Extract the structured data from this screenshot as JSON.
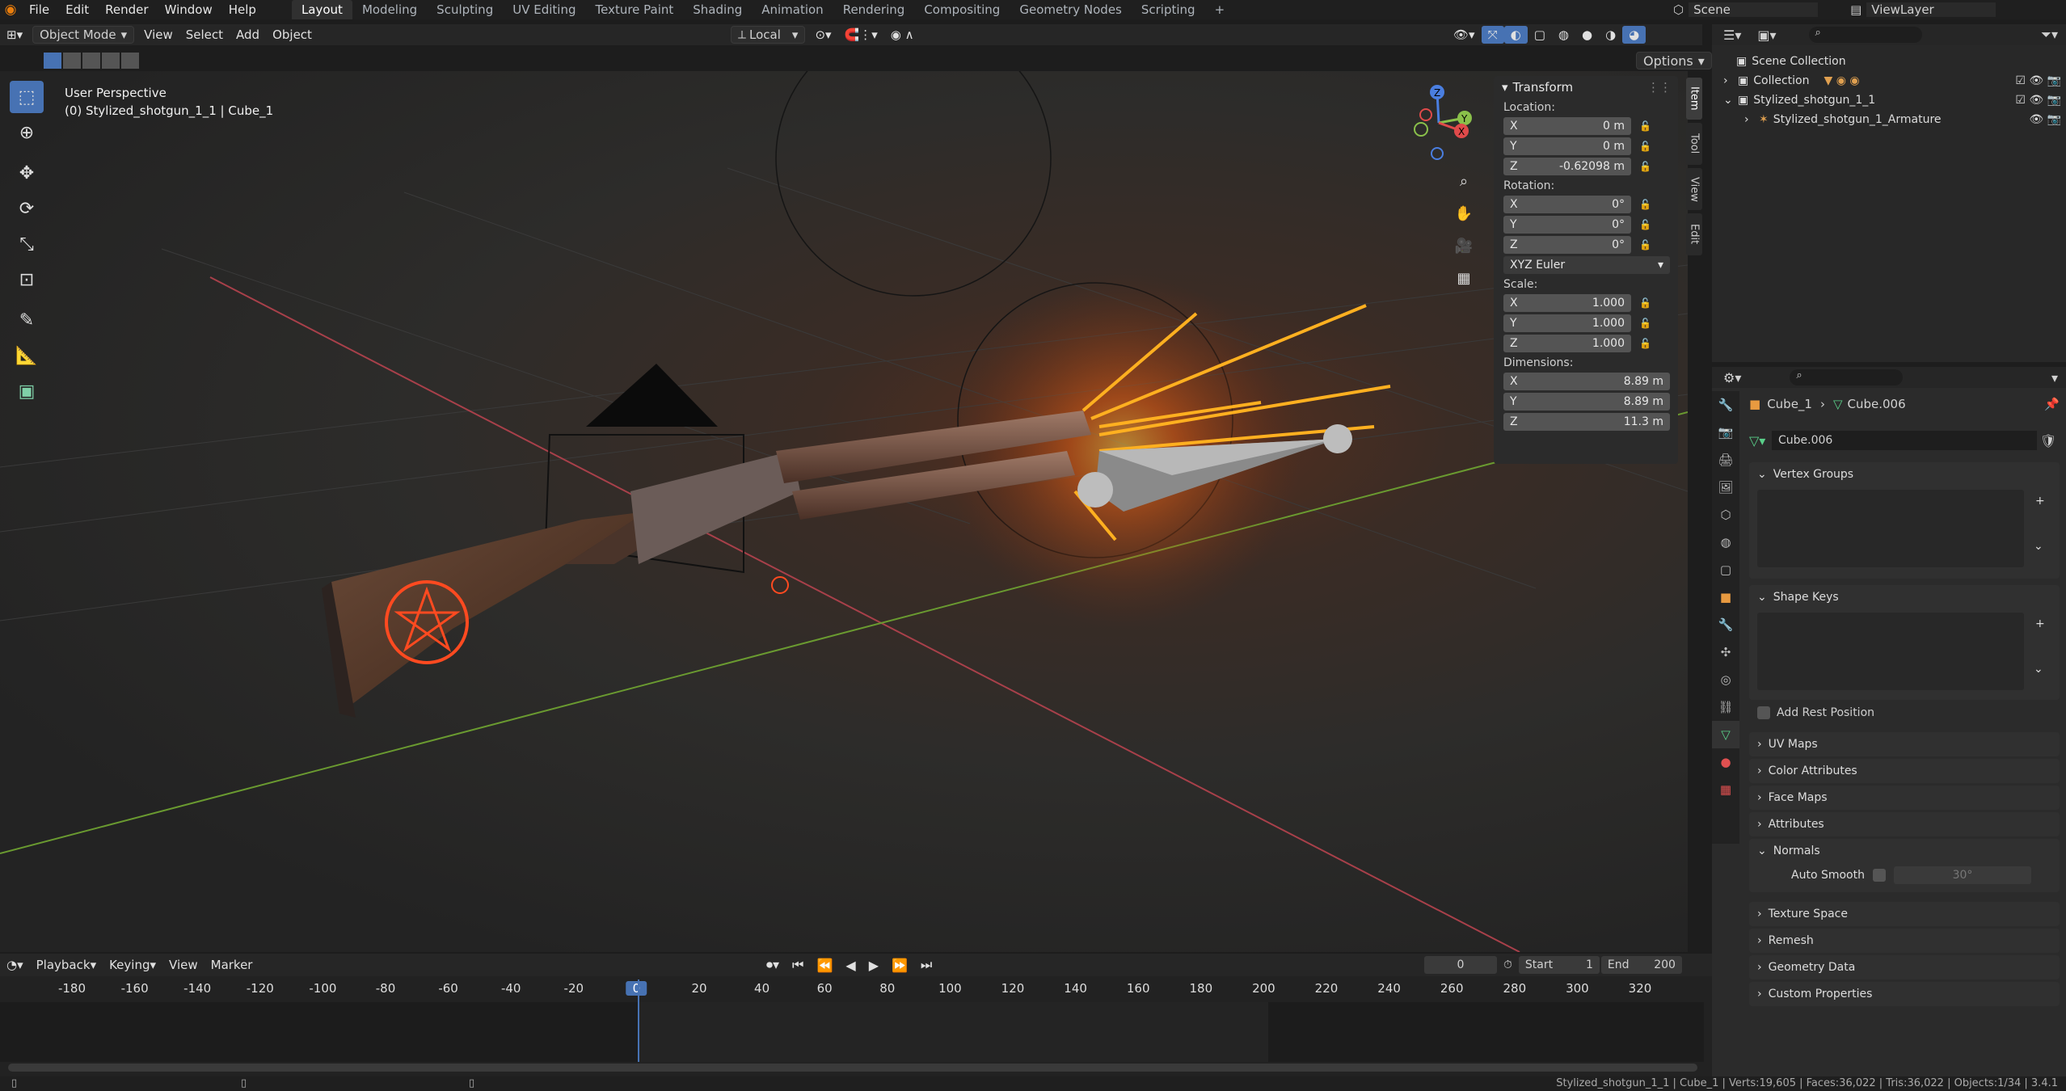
{
  "topbar": {
    "menus": [
      "File",
      "Edit",
      "Render",
      "Window",
      "Help"
    ],
    "workspaces": [
      "Layout",
      "Modeling",
      "Sculpting",
      "UV Editing",
      "Texture Paint",
      "Shading",
      "Animation",
      "Rendering",
      "Compositing",
      "Geometry Nodes",
      "Scripting"
    ],
    "active_workspace": "Layout",
    "scene": "Scene",
    "view_layer": "ViewLayer"
  },
  "viewport_header": {
    "mode": "Object Mode",
    "menus": [
      "View",
      "Select",
      "Add",
      "Object"
    ],
    "orientation": "Local",
    "options": "Options"
  },
  "viewport": {
    "perspective": "User Perspective",
    "object_info": "(0) Stylized_shotgun_1_1 | Cube_1"
  },
  "transform": {
    "title": "Transform",
    "location_label": "Location:",
    "location": {
      "x": "0 m",
      "y": "0 m",
      "z": "-0.62098 m"
    },
    "rotation_label": "Rotation:",
    "rotation": {
      "x": "0°",
      "y": "0°",
      "z": "0°"
    },
    "rotation_mode": "XYZ Euler",
    "scale_label": "Scale:",
    "scale": {
      "x": "1.000",
      "y": "1.000",
      "z": "1.000"
    },
    "dimensions_label": "Dimensions:",
    "dimensions": {
      "x": "8.89 m",
      "y": "8.89 m",
      "z": "11.3 m"
    },
    "axis": {
      "x": "X",
      "y": "Y",
      "z": "Z"
    }
  },
  "sidebar_tabs": [
    "Item",
    "Tool",
    "View",
    "Edit"
  ],
  "outliner": {
    "scene_collection": "Scene Collection",
    "collection": "Collection",
    "object": "Stylized_shotgun_1_1",
    "armature": "Stylized_shotgun_1_Armature"
  },
  "properties": {
    "object": "Cube_1",
    "mesh": "Cube.006",
    "mesh_field": "Cube.006",
    "panels": {
      "vertex_groups": "Vertex Groups",
      "shape_keys": "Shape Keys",
      "add_rest_position": "Add Rest Position",
      "uv_maps": "UV Maps",
      "color_attributes": "Color Attributes",
      "face_maps": "Face Maps",
      "attributes": "Attributes",
      "normals": "Normals",
      "auto_smooth": "Auto Smooth",
      "auto_smooth_angle": "30°",
      "texture_space": "Texture Space",
      "remesh": "Remesh",
      "geometry_data": "Geometry Data",
      "custom_properties": "Custom Properties"
    }
  },
  "timeline": {
    "menus": [
      "Playback",
      "Keying",
      "View",
      "Marker"
    ],
    "current_frame": "0",
    "start_label": "Start",
    "start": "1",
    "end_label": "End",
    "end": "200",
    "ruler": [
      "-180",
      "-160",
      "-140",
      "-120",
      "-100",
      "-80",
      "-60",
      "-40",
      "-20",
      "0",
      "20",
      "40",
      "60",
      "80",
      "100",
      "120",
      "140",
      "160",
      "180",
      "200",
      "220",
      "240",
      "260",
      "280",
      "300",
      "320"
    ]
  },
  "statusbar": {
    "text": "Stylized_shotgun_1_1 | Cube_1 | Verts:19,605 | Faces:36,022 | Tris:36,022 | Objects:1/34 | 3.4.1"
  }
}
